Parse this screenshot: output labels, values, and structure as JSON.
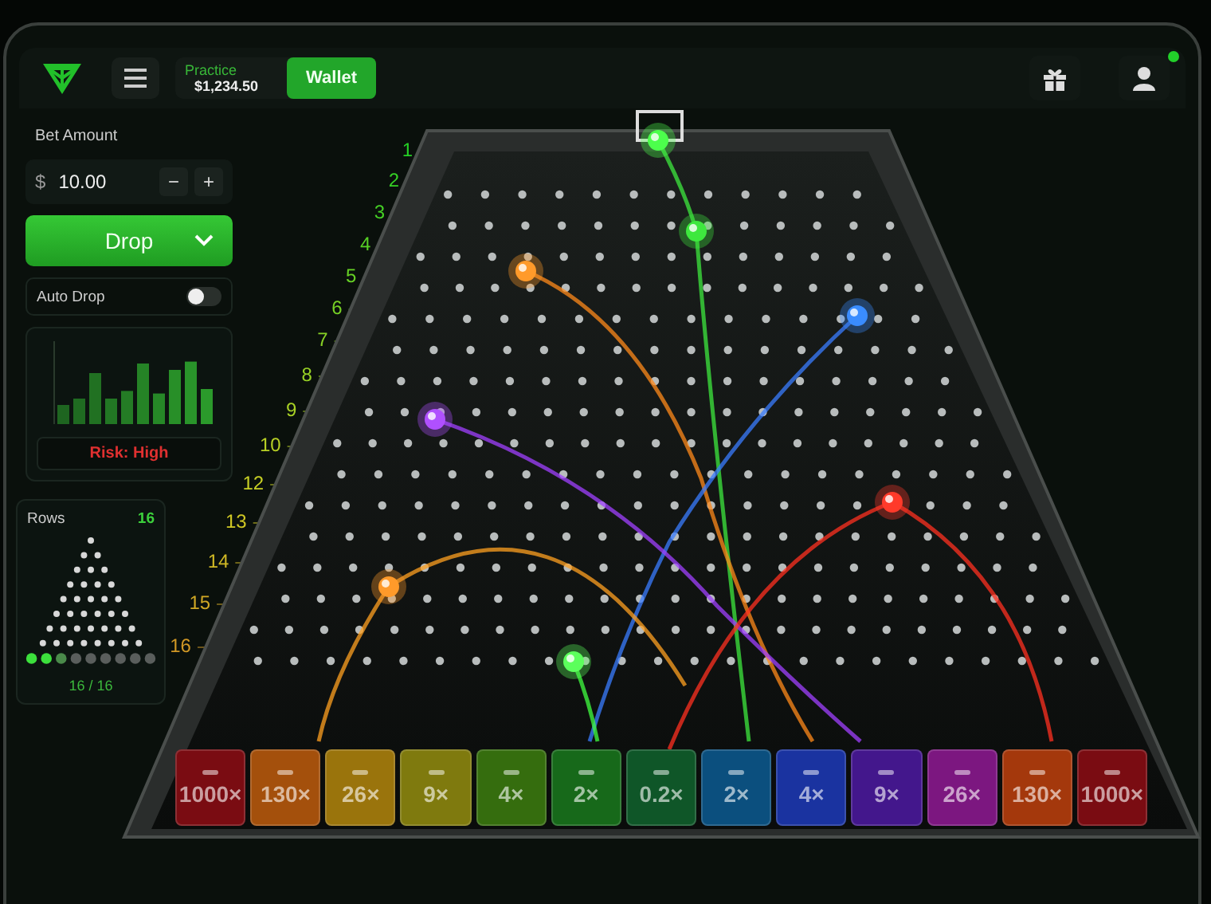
{
  "top_bar": {
    "practice_label": "Practice",
    "balance": "$1,234.50",
    "wallet_button": "Wallet"
  },
  "bet": {
    "label": "Bet Amount",
    "currency": "$",
    "value": "10.00",
    "minus": "−",
    "plus": "+"
  },
  "drop_button": "Drop",
  "auto_drop": {
    "label": "Auto Drop",
    "on": false
  },
  "risk": {
    "label": "Risk: High"
  },
  "rows": {
    "label": "Rows",
    "value": "16",
    "count": "16 / 16"
  },
  "row_numbers": [
    "1",
    "2",
    "3",
    "4",
    "5",
    "6",
    "7",
    "8",
    "9",
    "10",
    "12",
    "13",
    "14",
    "15",
    "16"
  ],
  "buckets": [
    {
      "label": "1000×",
      "color": "#7a0c12"
    },
    {
      "label": "130×",
      "color": "#a4500c"
    },
    {
      "label": "26×",
      "color": "#9a740c"
    },
    {
      "label": "9×",
      "color": "#7f7a0e"
    },
    {
      "label": "4×",
      "color": "#356d0e"
    },
    {
      "label": "2×",
      "color": "#17691a"
    },
    {
      "label": "0.2×",
      "color": "#0f5628"
    },
    {
      "label": "2×",
      "color": "#0b4f7e"
    },
    {
      "label": "4×",
      "color": "#1a33a0"
    },
    {
      "label": "9×",
      "color": "#43178c"
    },
    {
      "label": "26×",
      "color": "#7c1780"
    },
    {
      "label": "130×",
      "color": "#a4380c"
    },
    {
      "label": "1000×",
      "color": "#7a0c12"
    }
  ]
}
